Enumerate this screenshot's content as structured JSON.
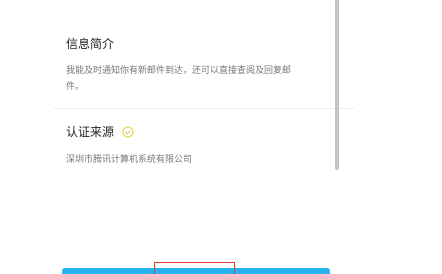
{
  "intro": {
    "title": "信息简介",
    "description": "我能及时通知你有新邮件到达，还可以直接查阅及回复邮件。"
  },
  "certification": {
    "title": "认证来源",
    "verified_icon": "verified-check-icon",
    "source": "深圳市腾讯计算机系统有限公司"
  },
  "colors": {
    "action_bar": "#29b2f0",
    "highlight": "#e23b3b",
    "verified_icon": "#f2c84b"
  }
}
